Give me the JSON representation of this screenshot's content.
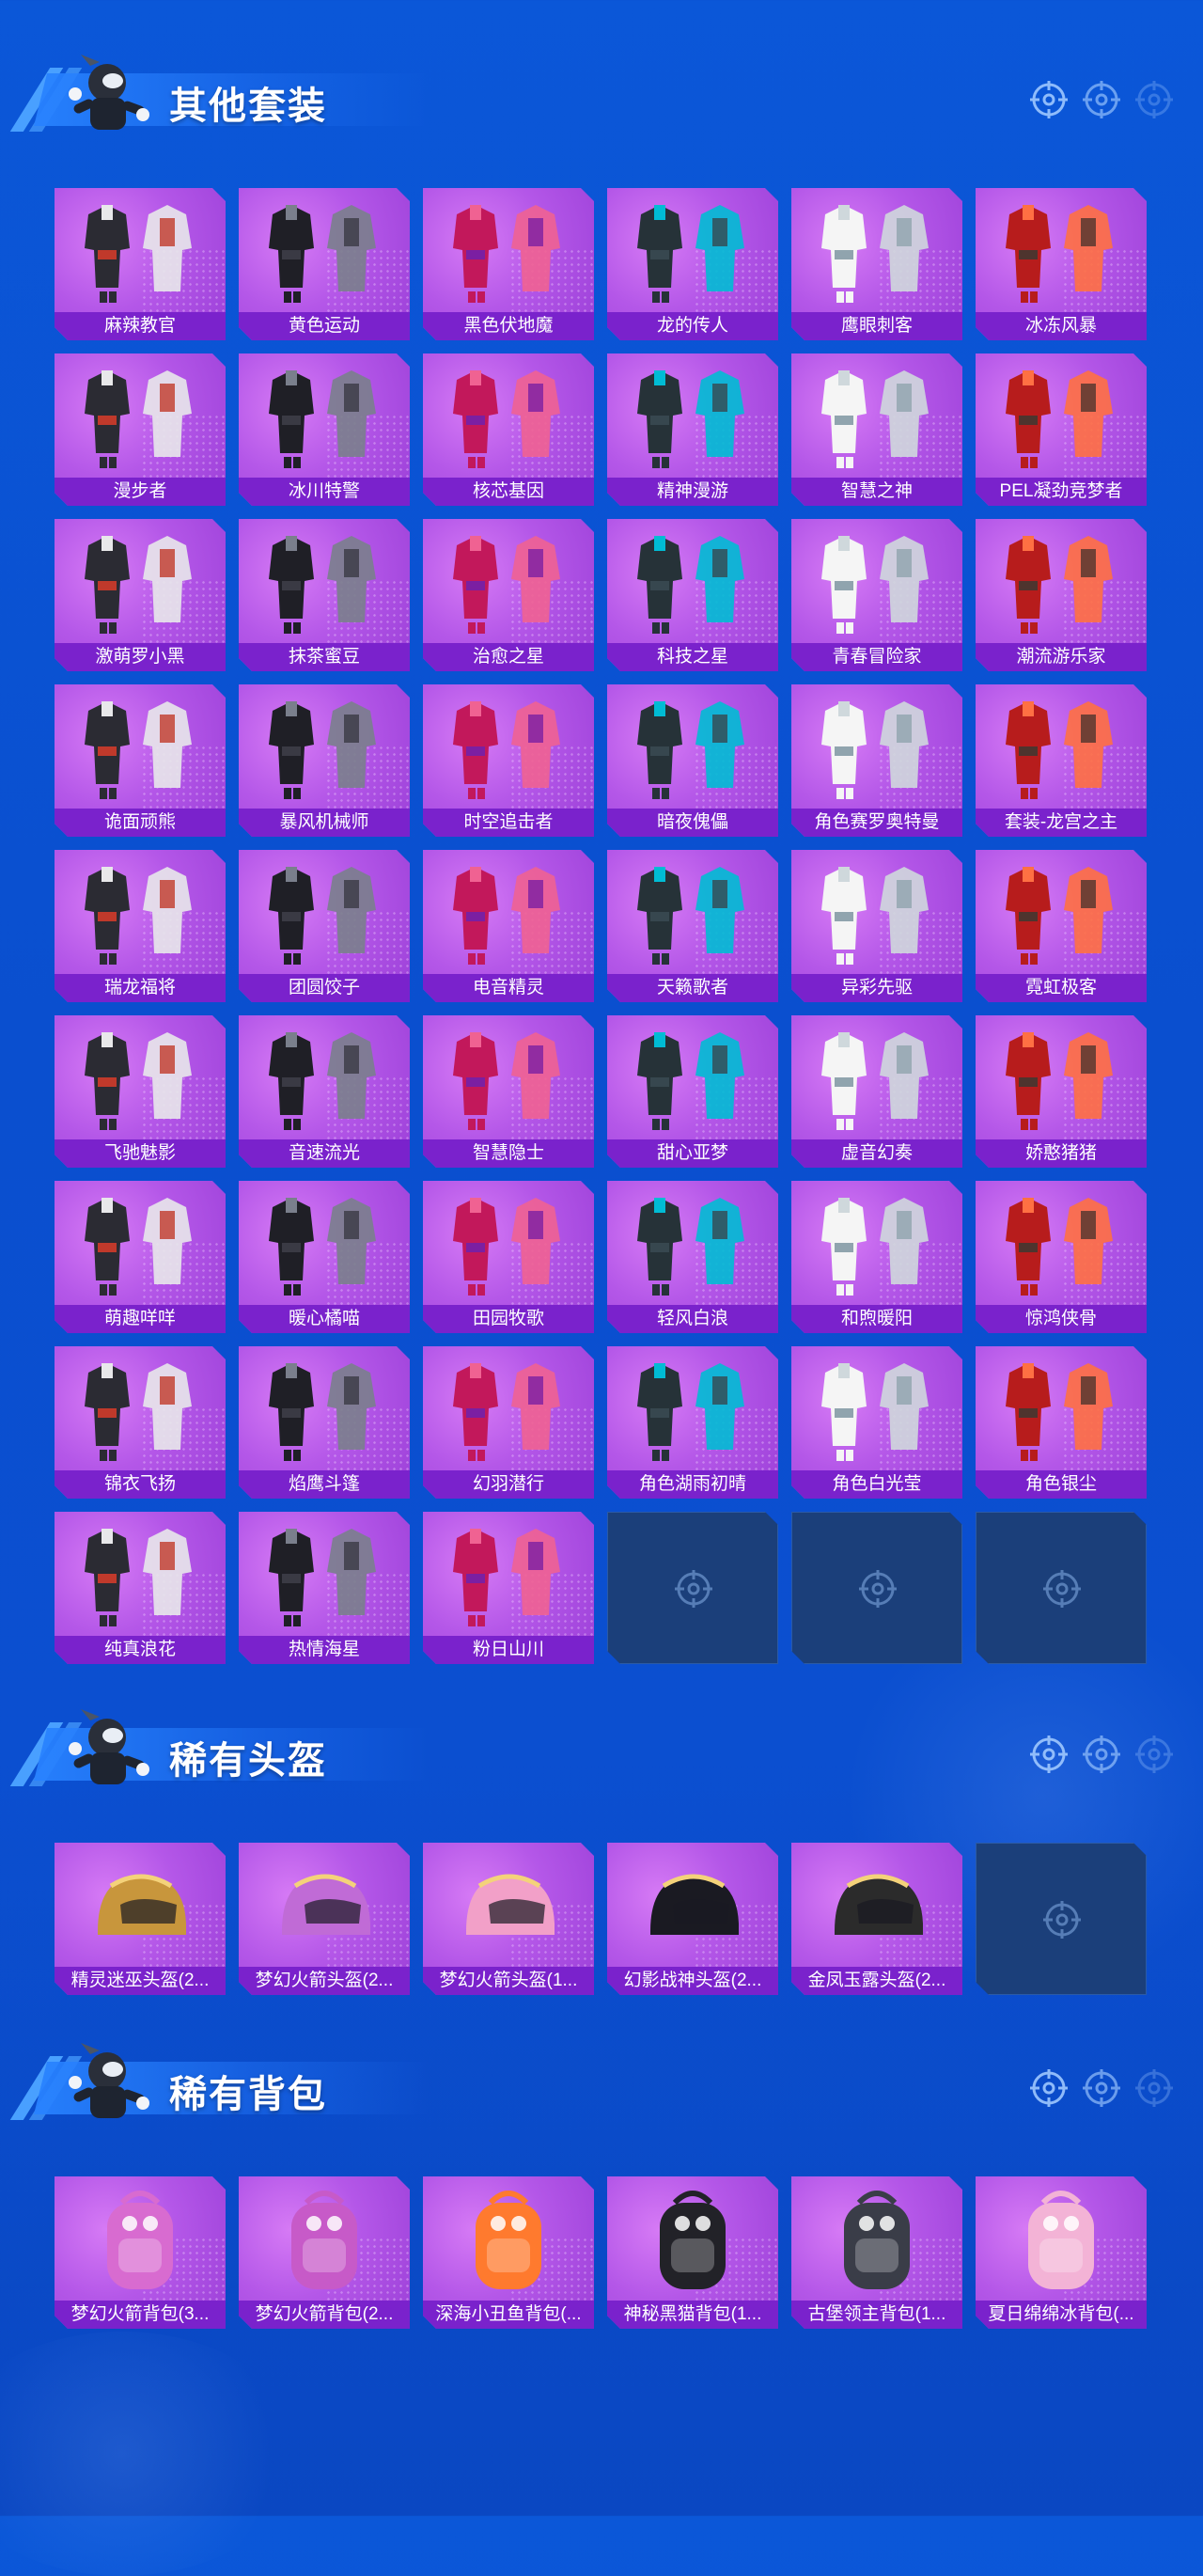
{
  "sections": [
    {
      "title": "其他套装",
      "items": [
        "麻辣教官",
        "黄色运动",
        "黑色伏地魔",
        "龙的传人",
        "鹰眼刺客",
        "冰冻风暴",
        "漫步者",
        "冰川特警",
        "核芯基因",
        "精神漫游",
        "智慧之神",
        "PEL凝劲竞梦者",
        "激萌罗小黑",
        "抹茶蜜豆",
        "治愈之星",
        "科技之星",
        "青春冒险家",
        "潮流游乐家",
        "诡面顽熊",
        "暴风机械师",
        "时空追击者",
        "暗夜傀儡",
        "角色赛罗奥特曼",
        "套装-龙宫之主",
        "瑞龙福将",
        "团圆饺子",
        "电音精灵",
        "天籁歌者",
        "异彩先驱",
        "霓虹极客",
        "飞驰魅影",
        "音速流光",
        "智慧隐士",
        "甜心亚梦",
        "虚音幻奏",
        "娇憨猪猪",
        "萌趣咩咩",
        "暖心橘喵",
        "田园牧歌",
        "轻风白浪",
        "和煦暖阳",
        "惊鸿侠骨",
        "锦衣飞扬",
        "焰鹰斗篷",
        "幻羽潜行",
        "角色湖雨初晴",
        "角色白光莹",
        "角色银尘",
        "纯真浪花",
        "热情海星",
        "粉日山川"
      ],
      "empty_slots": 3
    },
    {
      "title": "稀有头盔",
      "items": [
        "精灵迷巫头盔(2...",
        "梦幻火箭头盔(2...",
        "梦幻火箭头盔(1...",
        "幻影战神头盔(2...",
        "金凤玉露头盔(2..."
      ],
      "empty_slots": 1
    },
    {
      "title": "稀有背包",
      "items": [
        "梦幻火箭背包(3...",
        "梦幻火箭背包(2...",
        "深海小丑鱼背包(...",
        "神秘黑猫背包(1...",
        "古堡领主背包(1...",
        "夏日绵绵冰背包(..."
      ],
      "empty_slots": 0
    }
  ],
  "colors": {
    "background": "#0b52d4",
    "tile_purple": "#b457e8",
    "label_purple": "#7a22cc",
    "empty_tile": "#1b3f7a"
  },
  "icons": {
    "target": "crosshair-target-icon",
    "mascot": "mascot-icon",
    "outfit": "outfit-icon",
    "helmet": "helmet-icon",
    "backpack": "backpack-icon"
  }
}
